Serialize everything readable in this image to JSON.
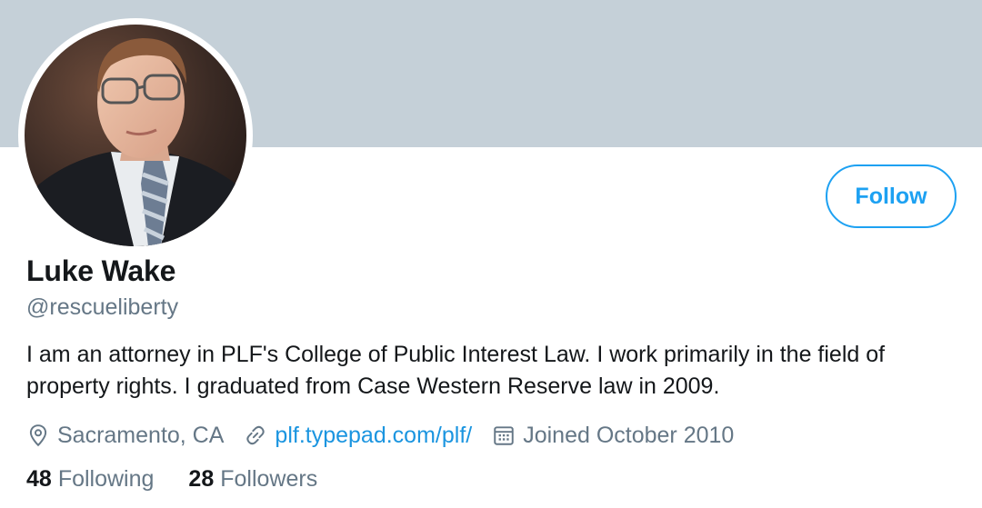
{
  "profile": {
    "name": "Luke Wake",
    "handle": "@rescueliberty",
    "bio": "I am an attorney in PLF's College of Public Interest Law. I work primarily in the field of property rights. I graduated from Case Western Reserve law in 2009.",
    "location": "Sacramento, CA",
    "website": "plf.typepad.com/plf/",
    "joined": "Joined October 2010"
  },
  "actions": {
    "follow_label": "Follow"
  },
  "stats": {
    "following_count": "48",
    "following_label": "Following",
    "followers_count": "28",
    "followers_label": "Followers"
  },
  "icons": {
    "location": "map-pin-icon",
    "website": "link-icon",
    "joined": "calendar-icon"
  },
  "colors": {
    "banner": "#c5d0d8",
    "accent": "#1da1f2",
    "link": "#1b95e0",
    "secondary_text": "#657786",
    "primary_text": "#14171a"
  }
}
